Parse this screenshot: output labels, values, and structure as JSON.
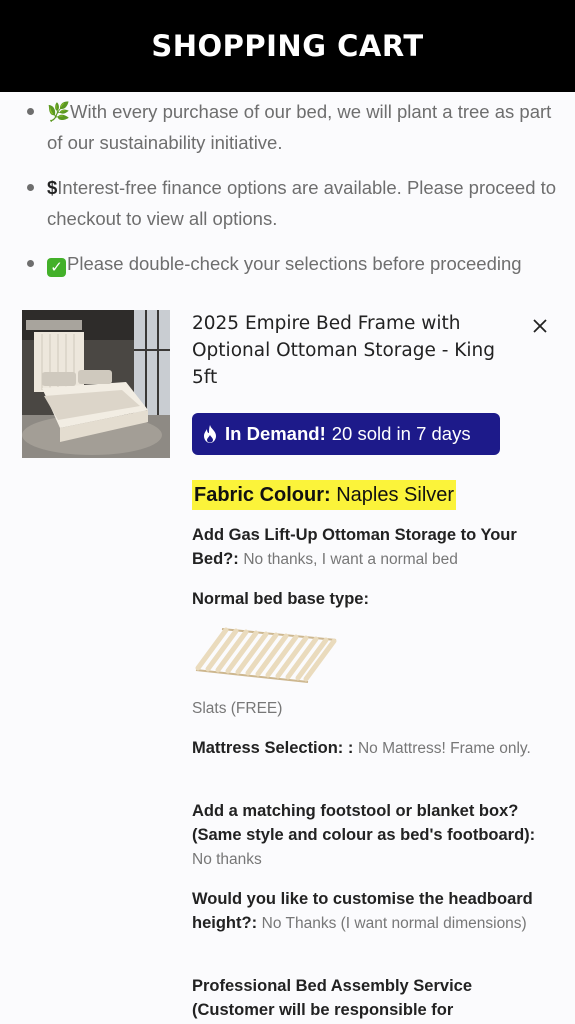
{
  "header": {
    "title": "SHOPPING CART"
  },
  "notes": [
    {
      "icon": "seedling-icon",
      "text": "With every purchase of our bed, we will plant a tree as part of our sustainability initiative."
    },
    {
      "icon": "dollar-icon",
      "text": "Interest-free finance options are available. Please proceed to checkout to view all options."
    },
    {
      "icon": "check-mark-icon",
      "text": "Please double-check your selections before proceeding"
    }
  ],
  "item": {
    "title": "2025 Empire Bed Frame with Optional Ottoman Storage - King 5ft",
    "badge": {
      "icon": "flame-icon",
      "strong": "In Demand!",
      "text": "20 sold in 7 days",
      "color": "#1d1a8a"
    },
    "fabric": {
      "label": "Fabric Colour:",
      "value": "Naples Silver",
      "highlight": "#fbf33a"
    },
    "options": [
      {
        "label": "Add Gas Lift-Up Ottoman Storage to Your Bed?:",
        "value": "No thanks, I want a normal bed"
      },
      {
        "label": "Normal bed base type:",
        "value": ""
      },
      {
        "label": "Mattress Selection: :",
        "value": "No Mattress! Frame only."
      },
      {
        "label": "Add a matching footstool or blanket box? (Same style and colour as bed's footboard):",
        "value": "No thanks"
      },
      {
        "label": "Would you like to customise the headboard height?:",
        "value": "No Thanks (I want normal dimensions)"
      },
      {
        "label": "Professional Bed Assembly Service (Customer will be responsible for",
        "value": ""
      }
    ],
    "base_image_caption": "Slats (FREE)"
  }
}
